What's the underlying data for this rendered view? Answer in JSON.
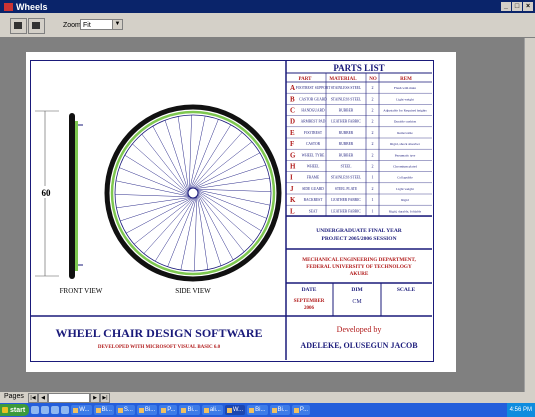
{
  "window": {
    "title": "Wheels"
  },
  "toolbar": {
    "zoom_label": "Zoom",
    "zoom_value": "Fit"
  },
  "pager": {
    "label": "Pages"
  },
  "drawing": {
    "front_view_label": "FRONT VIEW",
    "side_view_label": "SIDE VIEW",
    "dimension_label": "60",
    "parts_title": "PARTS LIST",
    "parts_headers": [
      "PART",
      "MATERIAL",
      "NO",
      "REM"
    ],
    "parts": [
      {
        "code": "A",
        "part": "FOOTREST SUPPORT",
        "material": "STAINLESS STEEL",
        "no": "2",
        "rem": "Flush with main"
      },
      {
        "code": "B",
        "part": "CASTOR GUARD",
        "material": "STAINLESS STEEL",
        "no": "2",
        "rem": "Light weight"
      },
      {
        "code": "C",
        "part": "HANDGUARD",
        "material": "RUBBER",
        "no": "2",
        "rem": "Adjustable for Required heights"
      },
      {
        "code": "D",
        "part": "ARMREST PAD",
        "material": "LEATHER FABRIC",
        "no": "2",
        "rem": "Durable cushion"
      },
      {
        "code": "E",
        "part": "FOOTREST",
        "material": "RUBBER",
        "no": "2",
        "rem": "Removable"
      },
      {
        "code": "F",
        "part": "CASTOR",
        "material": "RUBBER",
        "no": "2",
        "rem": "Rigid, shock absorber"
      },
      {
        "code": "G",
        "part": "WHEEL TYRE",
        "material": "RUBBER",
        "no": "2",
        "rem": "Pneumatic tyre"
      },
      {
        "code": "H",
        "part": "WHEEL",
        "material": "STEEL",
        "no": "2",
        "rem": "Chromium plated"
      },
      {
        "code": "I",
        "part": "FRAME",
        "material": "STAINLESS STEEL",
        "no": "1",
        "rem": "Collapsible"
      },
      {
        "code": "J",
        "part": "SIDE GUARD",
        "material": "STEEL PLATE",
        "no": "2",
        "rem": "Light weight"
      },
      {
        "code": "K",
        "part": "BACKREST",
        "material": "LEATHER FABRIC",
        "no": "1",
        "rem": "Rigid"
      },
      {
        "code": "L",
        "part": "SEAT",
        "material": "LEATHER FABRIC",
        "no": "1",
        "rem": "Rigid, durable, foldable"
      }
    ],
    "project_line1": "UNDERGRADUATE FINAL YEAR",
    "project_line2": "PROJECT 2005/2006 SESSION",
    "dept_line1": "MECHANICAL ENGINEERING DEPARTMENT,",
    "dept_line2": "FEDERAL UNIVERSITY OF TECHNOLOGY",
    "dept_line3": "AKURE",
    "date_label": "DATE",
    "date_value_1": "SEPTEMBER",
    "date_value_2": "2006",
    "dim_label": "DIM",
    "dim_value": "CM",
    "scale_label": "SCALE",
    "software_title": "WHEEL CHAIR DESIGN SOFTWARE",
    "software_subtitle": "DEVELOPED WITH MICROSOFT VISUAL BASIC 6.0",
    "developer_label": "Developed by",
    "developer_name": "ADELEKE, OLUSEGUN JACOB"
  },
  "taskbar": {
    "start_label": "start",
    "tasks": [
      "W...",
      "Bi...",
      "S...",
      "Bi...",
      "P...",
      "Bi...",
      "ali...",
      "W...",
      "Bi...",
      "Bi...",
      "P..."
    ],
    "clock": "4:56 PM"
  },
  "colors": {
    "border": "#1a1a7a",
    "tyre": "#7ec850",
    "accent_red": "#b01818",
    "title_bar": "#0a246a"
  }
}
